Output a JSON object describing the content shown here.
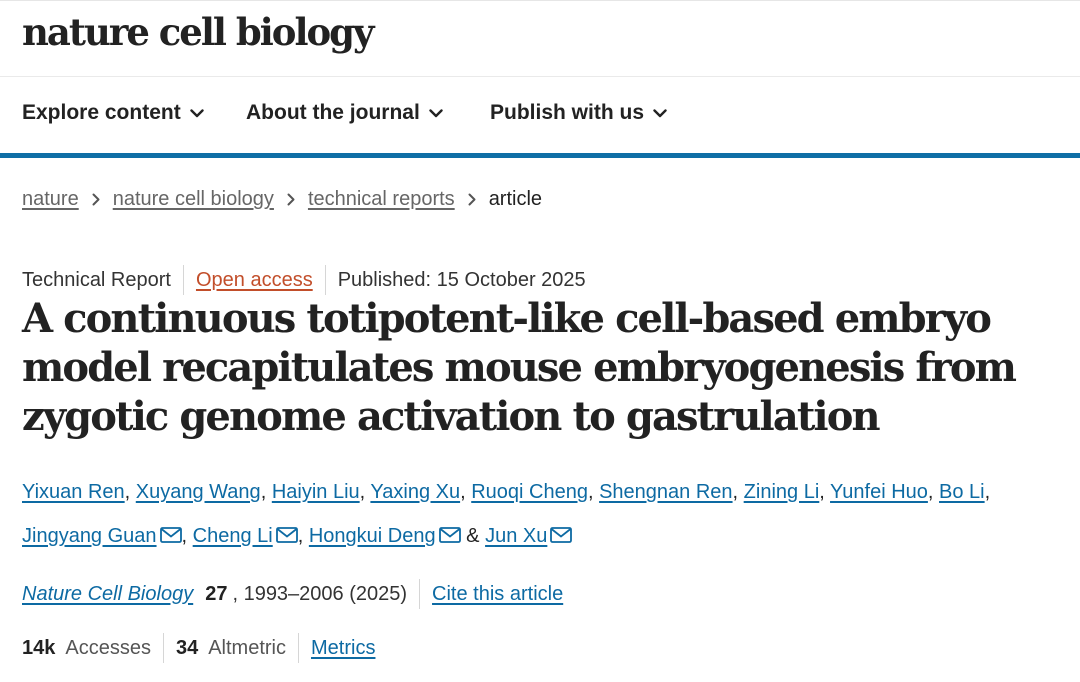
{
  "header": {
    "logo": "nature cell biology"
  },
  "nav": {
    "items": [
      {
        "label": "Explore content",
        "icon": "chevron-down-icon"
      },
      {
        "label": "About the journal",
        "icon": "chevron-down-icon"
      },
      {
        "label": "Publish with us",
        "icon": "chevron-down-icon"
      }
    ]
  },
  "breadcrumb": {
    "items": [
      "nature",
      "nature cell biology",
      "technical reports"
    ],
    "current": "article"
  },
  "article": {
    "type": "Technical Report",
    "access": "Open access",
    "published": "Published: 15 October 2025",
    "title": "A continuous totipotent-like cell-based embryo model recapitulates mouse embryogenesis from zygotic genome activation to gastrulation",
    "authors": [
      "Yixuan Ren",
      "Xuyang Wang",
      "Haiyin Liu",
      "Yaxing Xu",
      "Ruoqi Cheng",
      "Shengnan Ren",
      "Zining Li",
      "Yunfei Huo",
      "Bo Li",
      "Jingyang Guan",
      "Cheng Li",
      "Hongkui Deng",
      "Jun Xu"
    ],
    "and": "&",
    "citation": {
      "journal": "Nature Cell Biology",
      "volume": "27",
      "pages": ", 1993–2006 (2025)",
      "cite_label": "Cite this article"
    },
    "metrics": {
      "accesses_value": "14k",
      "accesses_label": "Accesses",
      "altmetric_value": "34",
      "altmetric_label": "Altmetric",
      "metrics_link": "Metrics"
    }
  },
  "colors": {
    "link_blue": "#0d6aa3",
    "open_access_orange": "#c24e2a",
    "nav_bar_blue": "#0f6fa6"
  }
}
